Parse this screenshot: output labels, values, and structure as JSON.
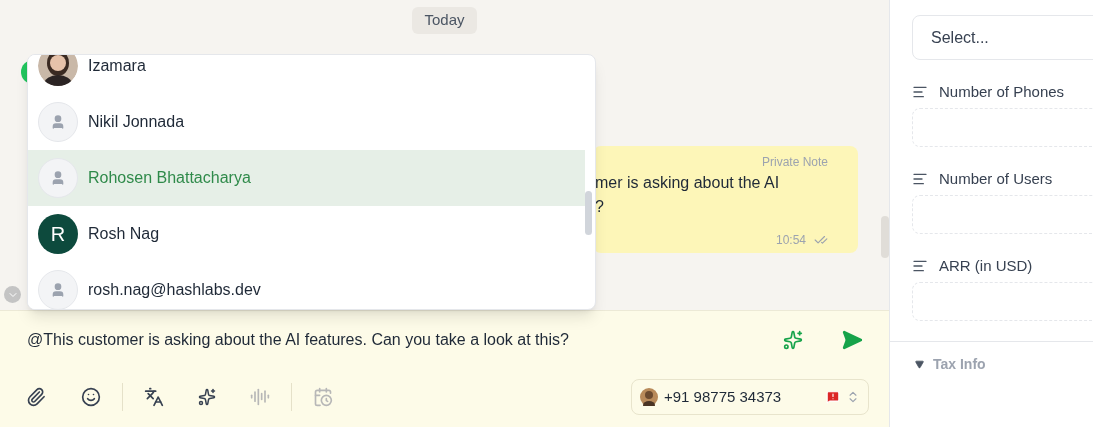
{
  "chat": {
    "date_divider": "Today",
    "note": {
      "label": "Private Note",
      "lines": [
        "mer is asking about the AI",
        "?"
      ],
      "time": "10:54"
    }
  },
  "mention_menu": {
    "items": [
      {
        "name": "Izamara",
        "selected": false
      },
      {
        "name": "Nikil Jonnada",
        "kind": "placeholder",
        "selected": false
      },
      {
        "name": "Rohosen Bhattacharya",
        "kind": "placeholder",
        "selected": true
      },
      {
        "name": "Rosh Nag",
        "kind": "initial",
        "initial": "R",
        "selected": false
      },
      {
        "name": "rosh.nag@hashlabs.dev",
        "kind": "placeholder",
        "selected": false
      }
    ]
  },
  "composer": {
    "value": "@This customer is asking about the AI features. Can you take a look at this?",
    "sender": {
      "phone": "+91 98775 34373"
    }
  },
  "sidebar": {
    "fields": [
      {
        "kind": "select",
        "placeholder": "Select..."
      },
      {
        "kind": "text",
        "label": "Number of Phones"
      },
      {
        "kind": "text",
        "label": "Number of Users"
      },
      {
        "kind": "text",
        "label": "ARR (in USD)"
      }
    ],
    "section": {
      "title": "Tax Info",
      "expanded": true
    }
  }
}
